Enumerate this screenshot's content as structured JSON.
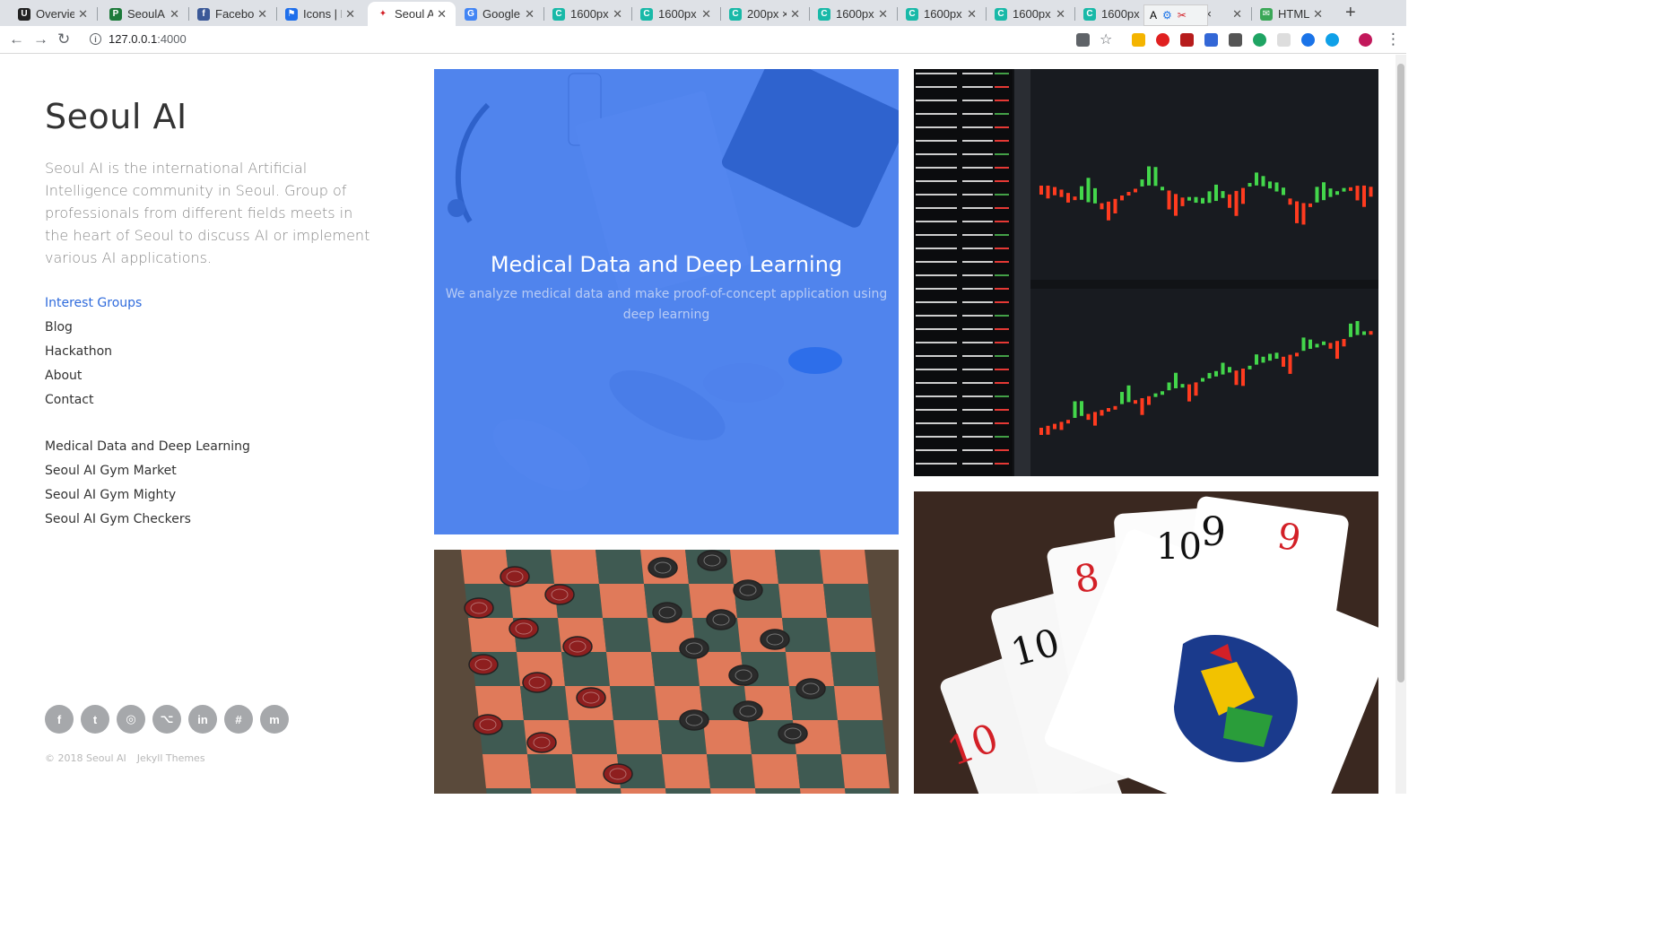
{
  "browser": {
    "tabs": [
      {
        "label": "Overvie",
        "favicon": "unity-icon",
        "color": "#222222",
        "glyph": "U"
      },
      {
        "label": "SeoulAI",
        "favicon": "pycharm-icon",
        "color": "#1d7a3a",
        "glyph": "P"
      },
      {
        "label": "Faceboo",
        "favicon": "facebook-icon",
        "color": "#3b5998",
        "glyph": "f"
      },
      {
        "label": "Icons | F",
        "favicon": "flag-icon",
        "color": "#1f6feb",
        "glyph": "⚑"
      },
      {
        "label": "Seoul AI",
        "favicon": "seoulai-icon",
        "color": "#ffffff",
        "glyph": "✦",
        "active": true
      },
      {
        "label": "Google",
        "favicon": "google-translate-icon",
        "color": "#4285f4",
        "glyph": "G"
      },
      {
        "label": "1600px",
        "favicon": "c-icon",
        "color": "#19b9a8",
        "glyph": "C"
      },
      {
        "label": "1600px",
        "favicon": "c-icon",
        "color": "#19b9a8",
        "glyph": "C"
      },
      {
        "label": "200px ×",
        "favicon": "c-icon",
        "color": "#19b9a8",
        "glyph": "C"
      },
      {
        "label": "1600px",
        "favicon": "c-icon",
        "color": "#19b9a8",
        "glyph": "C"
      },
      {
        "label": "1600px",
        "favicon": "c-icon",
        "color": "#19b9a8",
        "glyph": "C"
      },
      {
        "label": "1600px",
        "favicon": "c-icon",
        "color": "#19b9a8",
        "glyph": "C"
      },
      {
        "label": "1600px",
        "favicon": "c-icon",
        "color": "#19b9a8",
        "glyph": "C"
      },
      {
        "label": "px ×",
        "favicon": "c-icon",
        "color": "#19b9a8",
        "glyph": "C"
      },
      {
        "label": "HTML d",
        "favicon": "w3-icon",
        "color": "#3aa757",
        "glyph": "✉"
      }
    ],
    "url": "127.0.0.1",
    "port": ":4000"
  },
  "sidebar": {
    "title": "Seoul AI",
    "description": "Seoul AI is the international Artificial Intelligence community in Seoul. Group of professionals from different fields meets in the heart of Seoul to discuss AI or implement various AI applications.",
    "nav": [
      {
        "label": "Interest Groups",
        "active": true
      },
      {
        "label": "Blog"
      },
      {
        "label": "Hackathon"
      },
      {
        "label": "About"
      },
      {
        "label": "Contact"
      }
    ],
    "projects": [
      {
        "label": "Medical Data and Deep Learning"
      },
      {
        "label": "Seoul AI Gym Market"
      },
      {
        "label": "Seoul AI Gym Mighty"
      },
      {
        "label": "Seoul AI Gym Checkers"
      }
    ],
    "social": [
      {
        "name": "facebook-icon",
        "glyph": "f"
      },
      {
        "name": "twitter-icon",
        "glyph": "t"
      },
      {
        "name": "instagram-icon",
        "glyph": "◎"
      },
      {
        "name": "github-icon",
        "glyph": "⌥"
      },
      {
        "name": "linkedin-icon",
        "glyph": "in"
      },
      {
        "name": "slack-icon",
        "glyph": "#"
      },
      {
        "name": "meetup-icon",
        "glyph": "m"
      }
    ],
    "footer": {
      "copyright": "© 2018 Seoul AI",
      "theme": "Jekyll Themes"
    }
  },
  "cards": {
    "medical": {
      "title": "Medical Data and Deep Learning",
      "description": "We analyze medical data and make proof-of-concept application using deep learning",
      "overlay_color": "#2d6beb"
    },
    "market": {
      "alt": "stock market chart"
    },
    "mighty": {
      "alt": "playing cards"
    },
    "checkers": {
      "alt": "checkers board"
    }
  }
}
